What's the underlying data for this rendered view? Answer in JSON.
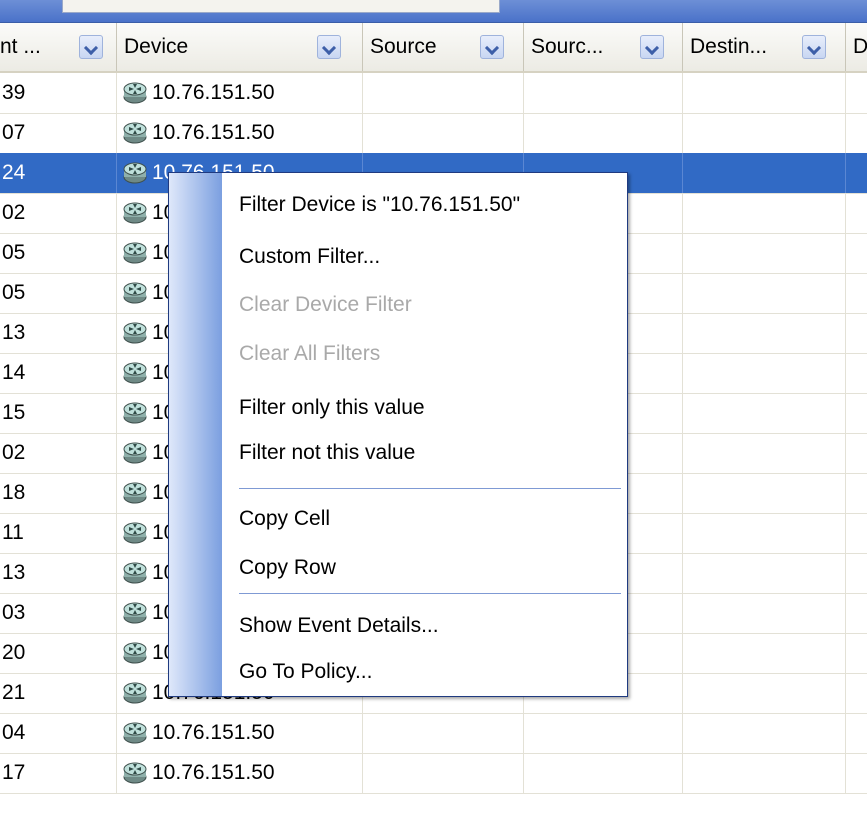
{
  "columns": [
    {
      "label": "nt ..."
    },
    {
      "label": "Device"
    },
    {
      "label": "Source"
    },
    {
      "label": "Sourc..."
    },
    {
      "label": "Destin..."
    },
    {
      "label": "D"
    }
  ],
  "rows": [
    {
      "id": "39",
      "device": "10.76.151.50"
    },
    {
      "id": "07",
      "device": "10.76.151.50"
    },
    {
      "id": "24",
      "device": "10.76.151.50",
      "selected": true
    },
    {
      "id": "02",
      "device": "10.76.151.50"
    },
    {
      "id": "05",
      "device": "10.76.151.50"
    },
    {
      "id": "05",
      "device": "10.76.151.50"
    },
    {
      "id": "13",
      "device": "10.76.151.50"
    },
    {
      "id": "14",
      "device": "10.76.151.50"
    },
    {
      "id": "15",
      "device": "10.76.151.50"
    },
    {
      "id": "02",
      "device": "10.76.151.50"
    },
    {
      "id": "18",
      "device": "10.76.151.50"
    },
    {
      "id": "11",
      "device": "10.76.151.50"
    },
    {
      "id": "13",
      "device": "10.76.151.50"
    },
    {
      "id": "03",
      "device": "10.76.151.50"
    },
    {
      "id": "20",
      "device": "10.76.151.50"
    },
    {
      "id": "21",
      "device": "10.76.151.50"
    },
    {
      "id": "04",
      "device": "10.76.151.50"
    },
    {
      "id": "17",
      "device": "10.76.151.50"
    }
  ],
  "context_menu": {
    "filter_device": "Filter Device is \"10.76.151.50\"",
    "custom_filter": "Custom Filter...",
    "clear_device_filter": "Clear Device Filter",
    "clear_all_filters": "Clear All Filters",
    "filter_only": "Filter only this value",
    "filter_not": "Filter not this value",
    "copy_cell": "Copy Cell",
    "copy_row": "Copy Row",
    "show_event_details": "Show Event Details...",
    "go_to_policy": "Go To Policy..."
  },
  "icons": {
    "device": "router-icon",
    "column_filter": "dropdown-arrow-icon"
  },
  "colors": {
    "selection": "#316ac5",
    "menu_gutter": "#7b9fe0",
    "disabled_text": "#a9a9a9"
  }
}
